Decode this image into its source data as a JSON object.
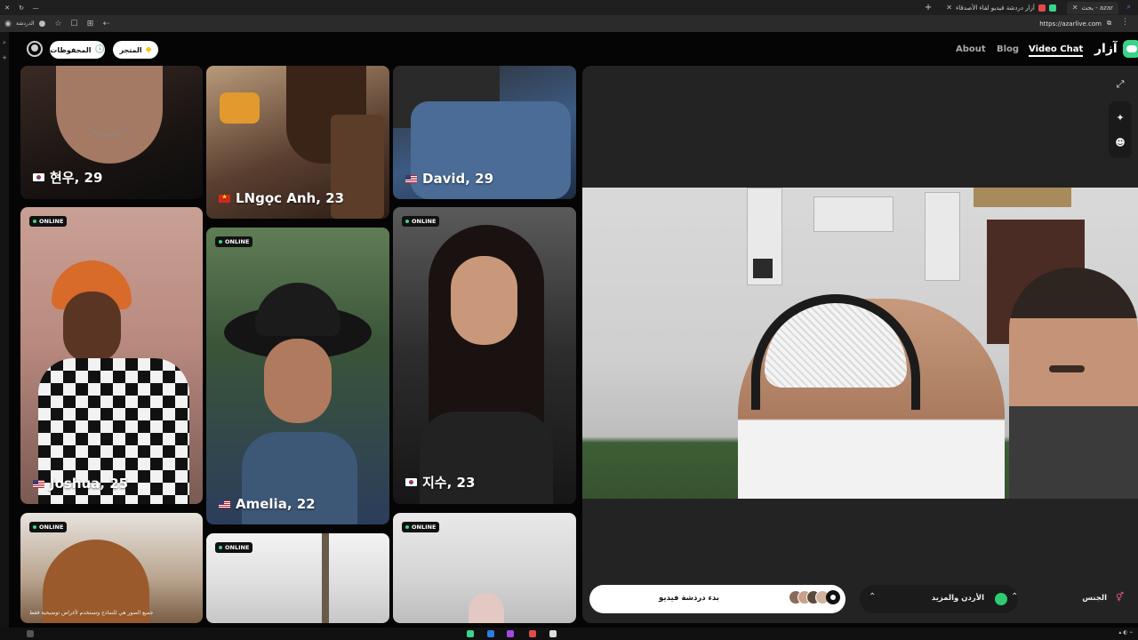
{
  "browser": {
    "tabs": [
      {
        "title": "بحث - azar"
      },
      {
        "title": "أزار دردشة فيديو لقاء الأصدقاء"
      }
    ],
    "url": "https://azarlive.com",
    "sidebar_label": "الدردشة"
  },
  "header": {
    "saved_label": "المحفوظات",
    "store_label": "المتجر",
    "nav": {
      "about": "About",
      "blog": "Blog",
      "video_chat": "Video Chat"
    },
    "brand": "آزار"
  },
  "cards": [
    {
      "name": "현우, 29",
      "online": "",
      "flag": "kr"
    },
    {
      "name": "LNgọc Anh, 23",
      "online": "",
      "flag": "vn"
    },
    {
      "name": "David, 29",
      "online": "",
      "flag": "us"
    },
    {
      "name": "Joshua, 25",
      "online": "ONLINE",
      "flag": "us"
    },
    {
      "name": "Amelia, 22",
      "online": "ONLINE",
      "flag": "us"
    },
    {
      "name": "지수, 23",
      "online": "ONLINE",
      "flag": "kr"
    },
    {
      "name": "",
      "online": "ONLINE",
      "flag": ""
    },
    {
      "name": "",
      "online": "ONLINE",
      "flag": ""
    },
    {
      "name": "",
      "online": "ONLINE",
      "flag": ""
    }
  ],
  "disclaimer": "جميع الصور هي للنماذج وتستخدم لأغراض توضيحية فقط",
  "controls": {
    "start_label": "بدء دردشة فيديو",
    "region_label": "الأردن والمزيد",
    "gender_label": "الجنس"
  },
  "colors": {
    "accent_green": "#38d48a",
    "online_dot": "#39d98a"
  }
}
